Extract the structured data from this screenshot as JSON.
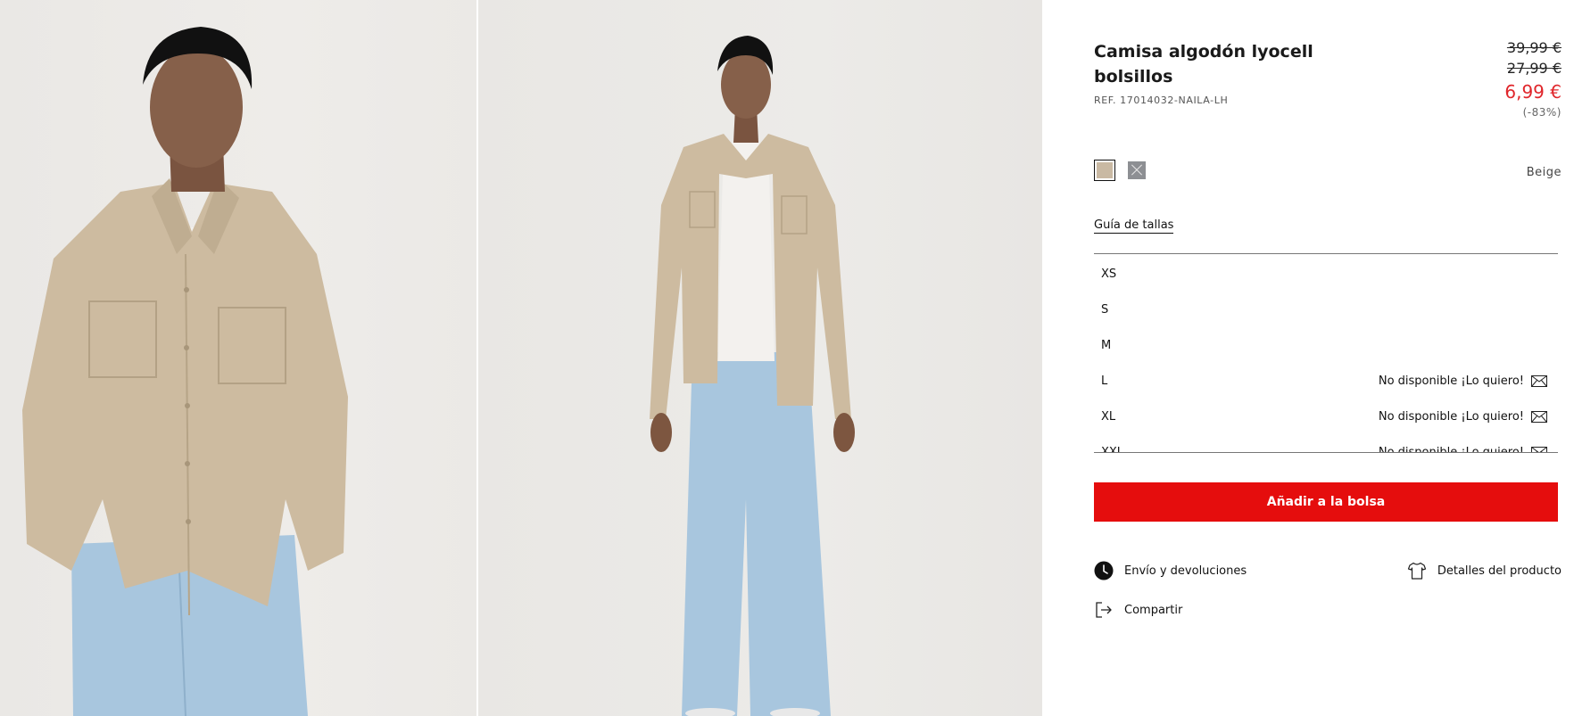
{
  "product": {
    "title": "Camisa algodón lyocell bolsillos",
    "reference": "REF. 17014032-NAILA-LH",
    "prices": {
      "original": "39,99 €",
      "previous": "27,99 €",
      "current": "6,99 €",
      "discount": "(-83%)"
    },
    "colors": {
      "selected_name": "Beige",
      "swatches": [
        {
          "name": "beige-swatch",
          "hex": "#c9b9a3",
          "selected": true,
          "available": true
        },
        {
          "name": "grey-swatch",
          "hex": "#8d8f93",
          "selected": false,
          "available": false
        }
      ]
    }
  },
  "size_guide_label": "Guía de tallas",
  "sizes": [
    {
      "label": "XS",
      "status": ""
    },
    {
      "label": "S",
      "status": ""
    },
    {
      "label": "M",
      "status": ""
    },
    {
      "label": "L",
      "status": "No disponible ¡Lo quiero!"
    },
    {
      "label": "XL",
      "status": "No disponible ¡Lo quiero!"
    },
    {
      "label": "XXL",
      "status": "No disponible ¡Lo quiero!"
    }
  ],
  "actions": {
    "add_to_bag": "Añadir a la bolsa",
    "shipping": "Envío y devoluciones",
    "details": "Detalles del producto",
    "share": "Compartir"
  },
  "icons": {
    "shipping": "clock-icon",
    "details": "tshirt-icon",
    "share": "share-icon",
    "notify": "mail-icon"
  },
  "colors_ui": {
    "accent_red": "#e50d0d",
    "sale_price": "#e0262b"
  }
}
